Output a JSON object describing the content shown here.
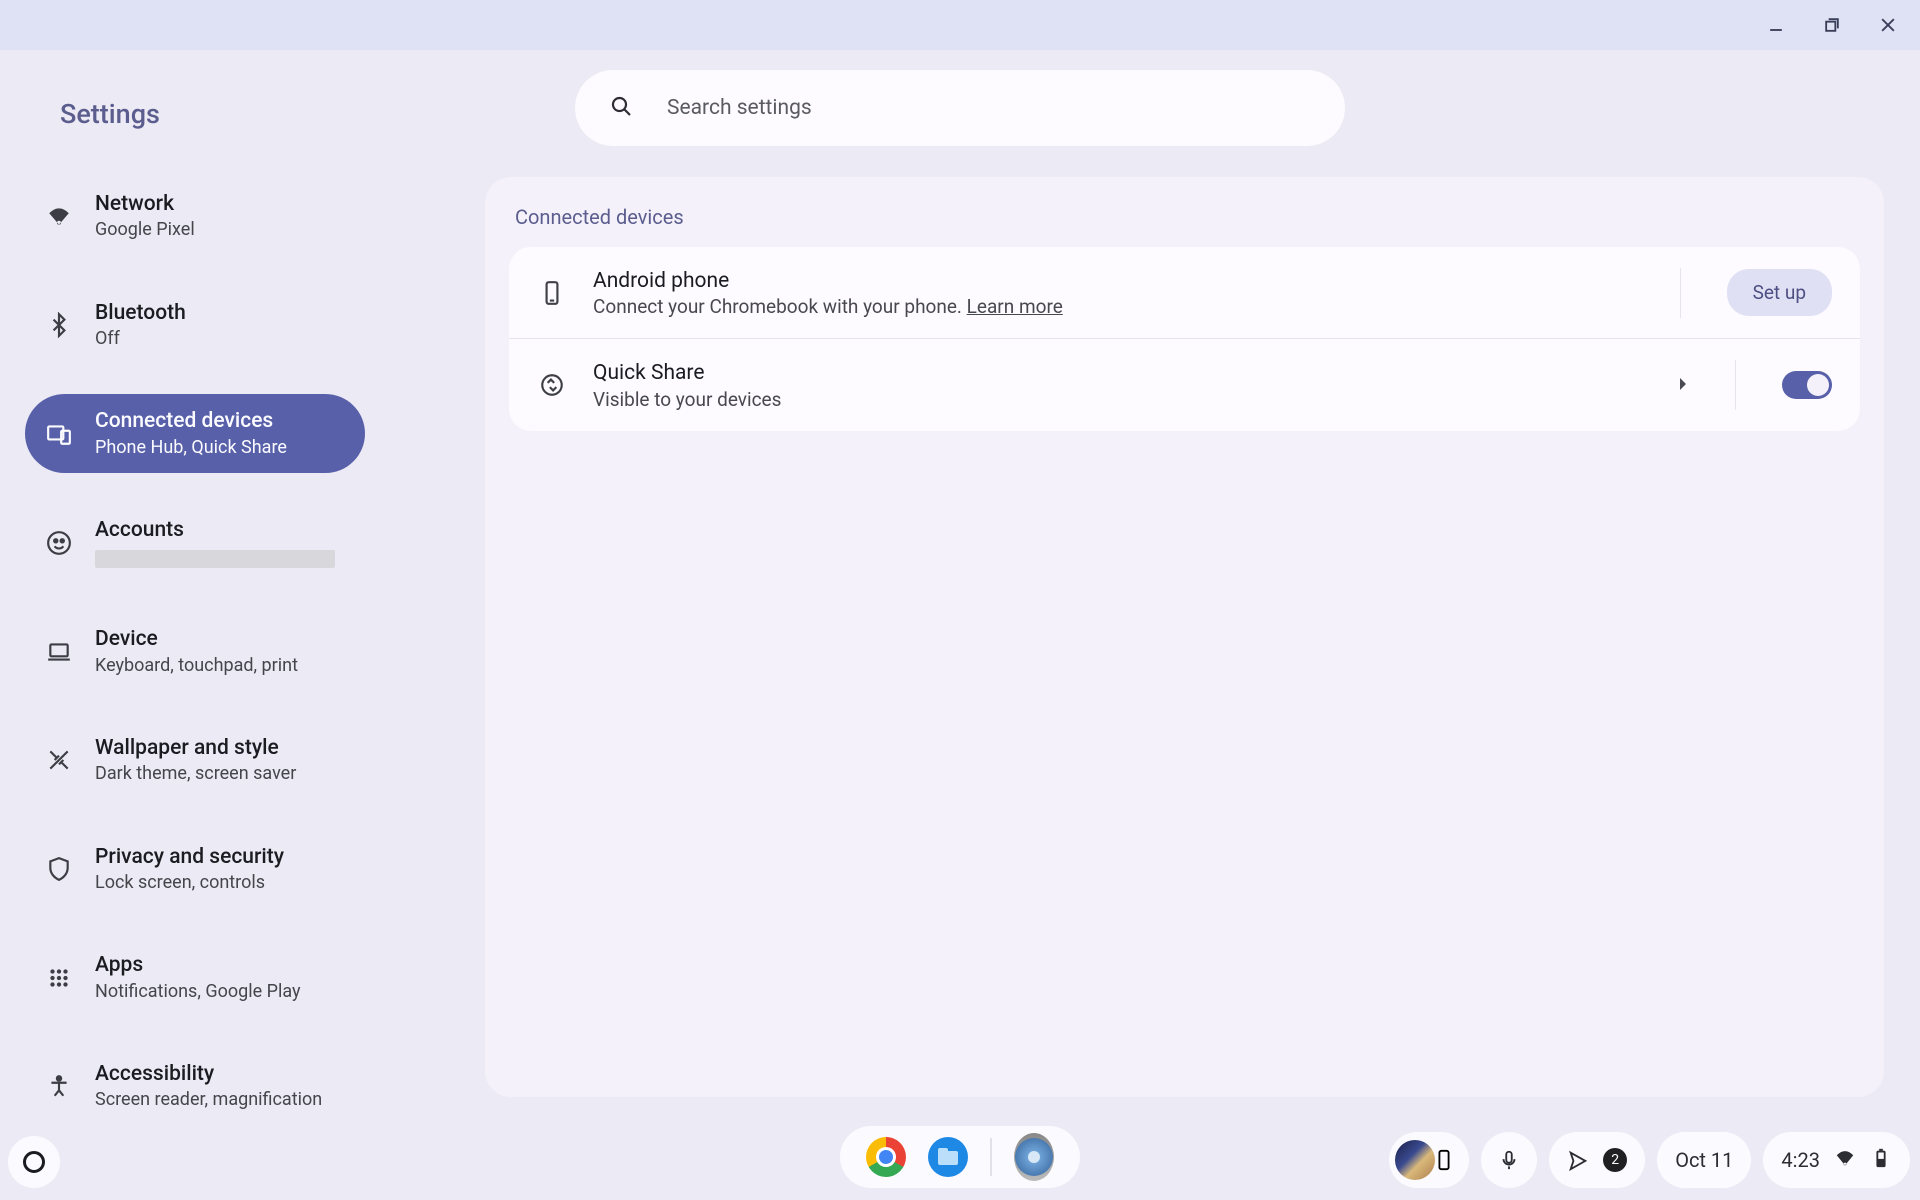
{
  "window": {
    "app_title": "Settings"
  },
  "search": {
    "placeholder": "Search settings"
  },
  "sidebar": {
    "items": [
      {
        "title": "Network",
        "sub": "Google Pixel",
        "icon": "wifi"
      },
      {
        "title": "Bluetooth",
        "sub": "Off",
        "icon": "bluetooth"
      },
      {
        "title": "Connected devices",
        "sub": "Phone Hub, Quick Share",
        "icon": "devices",
        "active": true
      },
      {
        "title": "Accounts",
        "sub": "",
        "icon": "account",
        "redacted": true
      },
      {
        "title": "Device",
        "sub": "Keyboard, touchpad, print",
        "icon": "laptop"
      },
      {
        "title": "Wallpaper and style",
        "sub": "Dark theme, screen saver",
        "icon": "palette"
      },
      {
        "title": "Privacy and security",
        "sub": "Lock screen, controls",
        "icon": "shield"
      },
      {
        "title": "Apps",
        "sub": "Notifications, Google Play",
        "icon": "apps"
      },
      {
        "title": "Accessibility",
        "sub": "Screen reader, magnification",
        "icon": "a11y"
      }
    ]
  },
  "panel": {
    "heading": "Connected devices",
    "android_phone": {
      "title": "Android phone",
      "desc_prefix": "Connect your Chromebook with your phone. ",
      "learn_more": "Learn more",
      "button": "Set up"
    },
    "quick_share": {
      "title": "Quick Share",
      "desc": "Visible to your devices",
      "toggle_on": true
    }
  },
  "shelf": {
    "date": "Oct 11",
    "time": "4:23",
    "notif_badge": "2"
  }
}
